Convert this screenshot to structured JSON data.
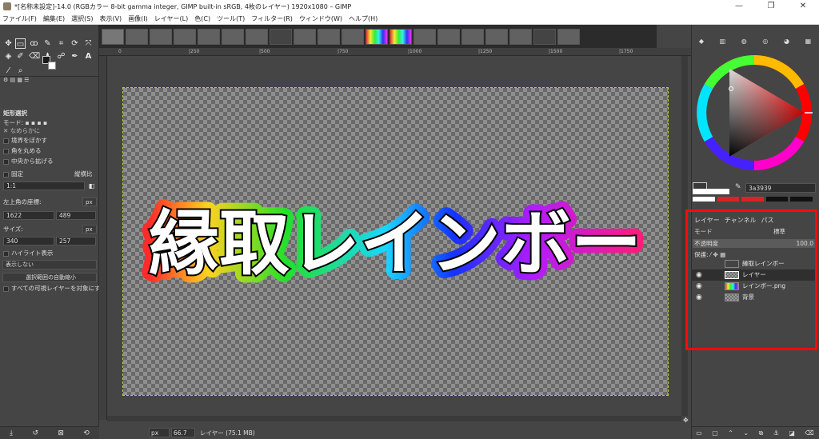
{
  "window": {
    "title": "*[名称未設定]-14.0 (RGBカラー 8-bit gamma integer, GIMP built-in sRGB, 4枚のレイヤー) 1920x1080 – GIMP",
    "minimize": "—",
    "maximize": "❐",
    "close": "✕"
  },
  "menu": [
    "ファイル(F)",
    "編集(E)",
    "選択(S)",
    "表示(V)",
    "画像(I)",
    "レイヤー(L)",
    "色(C)",
    "ツール(T)",
    "フィルター(R)",
    "ウィンドウ(W)",
    "ヘルプ(H)"
  ],
  "tool_options": {
    "title": "矩形選択",
    "mode_label": "モード:",
    "antialias": "なめらかに",
    "feather": "境界をぼかす",
    "rounded": "角を丸める",
    "expand_center": "中央から拡げる",
    "fixed_label": "固定",
    "fixed_mode": "縦横比",
    "ratio": "1:1",
    "position_label": "左上角の座標:",
    "pos_x": "1622",
    "pos_y": "489",
    "size_label": "サイズ:",
    "size_w": "340",
    "size_h": "257",
    "unit": "px",
    "highlight": "ハイライト表示",
    "guides": "表示しない",
    "auto_shrink": "選択範囲の自動縮小",
    "all_visible": "すべての可視レイヤーを対象にす"
  },
  "rulers": [
    "0",
    "|250",
    "|500",
    "|750",
    "|1000",
    "|1250",
    "|1500",
    "|1750"
  ],
  "canvas_text": "縁取レインボー",
  "statusbar": {
    "unit": "px",
    "zoom": "66.7",
    "message": "レイヤー (75.1 MB)"
  },
  "color": {
    "hex": "3a3939",
    "fg": "#1a1a1a",
    "accent": "#ff0a0a"
  },
  "layers_panel": {
    "tab_layers": "レイヤー",
    "tab_channels": "チャンネル",
    "tab_paths": "パス",
    "mode_label": "モード",
    "mode_value": "標準",
    "opacity_label": "不透明度",
    "opacity_value": "100.0",
    "lock_label": "保護:",
    "layers": [
      {
        "name": "縁取レインボー",
        "visible": false,
        "selected": false
      },
      {
        "name": "レイヤー",
        "visible": true,
        "selected": true
      },
      {
        "name": "レインボー.png",
        "visible": true,
        "selected": false
      },
      {
        "name": "背景",
        "visible": true,
        "selected": false
      }
    ]
  }
}
